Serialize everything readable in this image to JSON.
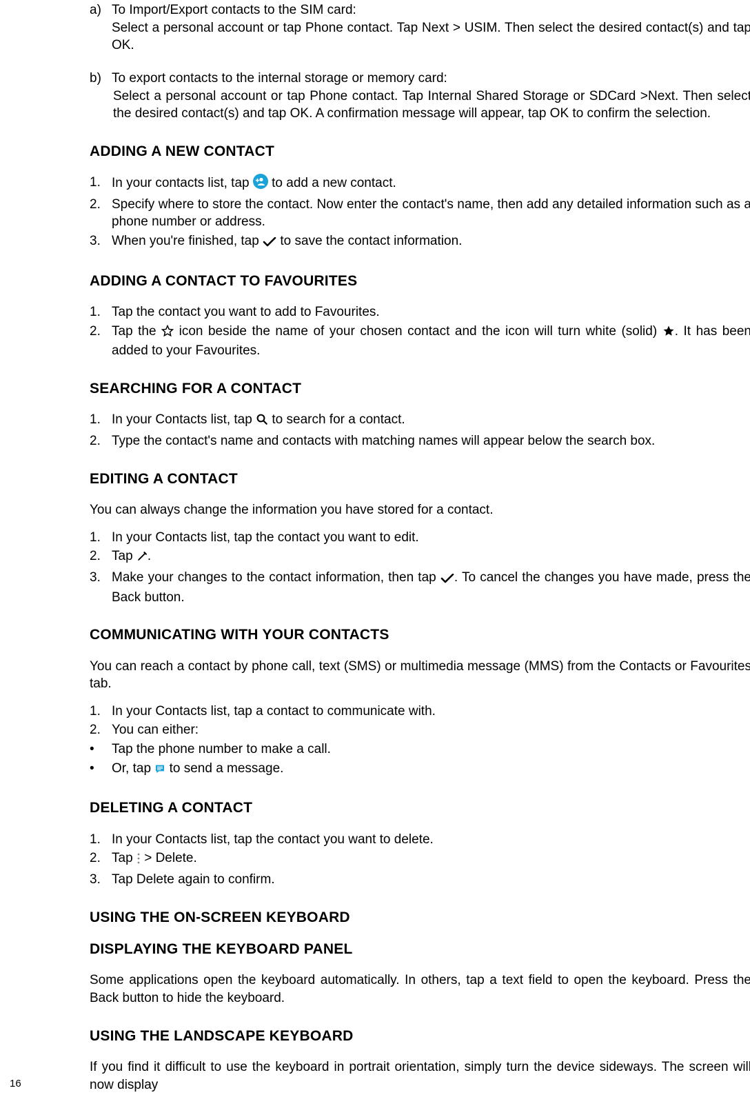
{
  "letterA": {
    "label": "a)",
    "title": "To Import/Export contacts to the SIM card:",
    "body": "Select a personal account or tap Phone contact. Tap Next > USIM. Then select the desired contact(s) and tap OK."
  },
  "letterB": {
    "label": "b)",
    "title": "To export contacts to the internal storage or memory card:",
    "body": "Select a personal account or tap Phone contact. Tap Internal Shared Storage or SDCard >Next. Then select the desired contact(s) and tap OK. A confirmation message will appear, tap OK to confirm the selection."
  },
  "h_addNew": "ADDING A NEW CONTACT",
  "addNew": {
    "i1a": "In your contacts list, tap ",
    "i1b": " to add a new contact.",
    "i2": "Specify where to store the contact. Now enter the contact's name, then add any detailed information such as a phone number or address.",
    "i3a": "When you're finished, tap ",
    "i3b": " to save the contact information."
  },
  "h_fav": "ADDING A CONTACT TO FAVOURITES",
  "fav": {
    "i1": "Tap the contact you want to add to Favourites.",
    "i2a": "Tap the ",
    "i2b": " icon beside the name of your chosen contact and the icon will turn white (solid) ",
    "i2c": ". It has been added to your Favourites."
  },
  "h_search": "SEARCHING FOR A CONTACT",
  "search": {
    "i1a": "In your Contacts list, tap ",
    "i1b": " to search for a contact.",
    "i2": "Type the contact's name and contacts with matching names will appear below the search box."
  },
  "h_edit": "EDITING A CONTACT",
  "edit_intro": "You can always change the information you have stored for a contact.",
  "edit": {
    "i1": "In your Contacts list, tap the contact you want to edit.",
    "i2a": "Tap ",
    "i2b": ".",
    "i3a": "Make your changes to the contact information, then tap ",
    "i3b": ". To cancel the changes you have made, press the Back button."
  },
  "h_comm": "COMMUNICATING WITH YOUR CONTACTS",
  "comm_intro": "You can reach a contact by phone call, text (SMS) or multimedia message (MMS) from the Contacts or Favourites tab.",
  "comm": {
    "i1": "In your Contacts list, tap a contact to communicate with.",
    "i2": "You can either:",
    "b1": "Tap the phone number to make a call.",
    "b2a": "Or, tap ",
    "b2b": " to send a message."
  },
  "h_del": "DELETING A CONTACT",
  "del": {
    "i1": "In your Contacts list, tap the contact you want to delete.",
    "i2a": "Tap ",
    "i2b": " > Delete.",
    "i3": "Tap Delete again to confirm."
  },
  "h_kb": "USING THE ON-SCREEN KEYBOARD",
  "h_kb_panel": "DISPLAYING THE KEYBOARD PANEL",
  "kb_panel": "Some applications open the keyboard automatically. In others, tap a text field to open the keyboard. Press the Back button to hide the keyboard.",
  "h_kb_land": "USING THE LANDSCAPE KEYBOARD",
  "kb_land": "If you find it difficult to use the keyboard in portrait orientation, simply turn the device sideways. The screen will now display",
  "pagenum": "16",
  "nums": {
    "n1": "1.",
    "n2": "2.",
    "n3": "3.",
    "bul": "•"
  }
}
